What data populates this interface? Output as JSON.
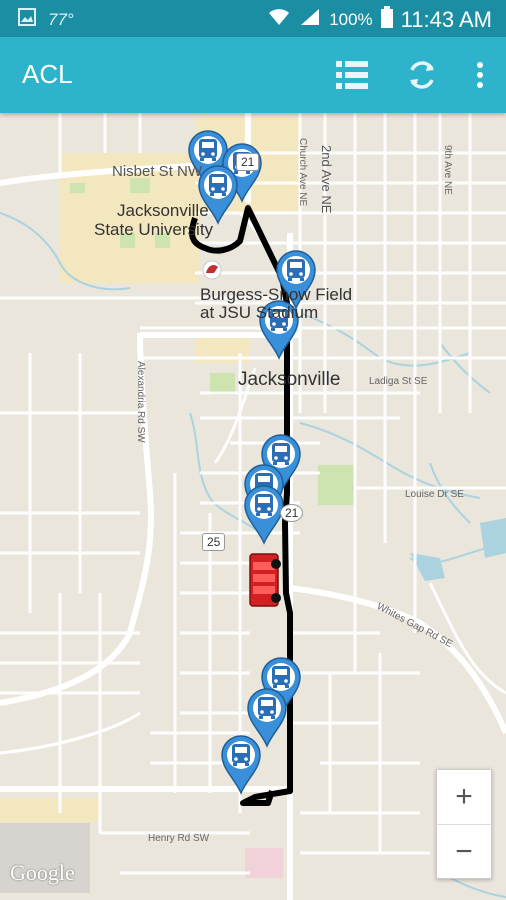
{
  "status_bar": {
    "temperature": "77°",
    "battery": "100%",
    "time": "11:43 AM"
  },
  "app_bar": {
    "title": "ACL"
  },
  "map": {
    "labels": {
      "nisbet": "Nisbet St NW",
      "jsu_line1": "Jacksonville",
      "jsu_line2": "State University",
      "stadium_line1": "Burgess-Snow Field",
      "stadium_line2": "at JSU Stadium",
      "city": "Jacksonville",
      "ladiga": "Ladiga St SE",
      "louise": "Louise Dr SE",
      "whites_gap": "Whites Gap Rd SE",
      "henry": "Henry Rd SW",
      "church": "Church Ave NE",
      "second_ave": "2nd Ave NE",
      "ninth_ave": "9th Ave NE",
      "alexandria": "Alexandria Rd SW",
      "route21": "21",
      "route21b": "21",
      "route25": "25"
    },
    "zoom": {
      "in": "+",
      "out": "−"
    },
    "attribution": "Google"
  },
  "colors": {
    "status_bar": "#1c8ea3",
    "app_bar": "#2db3cb",
    "route": "#000000",
    "bus_marker": "#3a8fd9",
    "live_bus": "#d42020"
  }
}
